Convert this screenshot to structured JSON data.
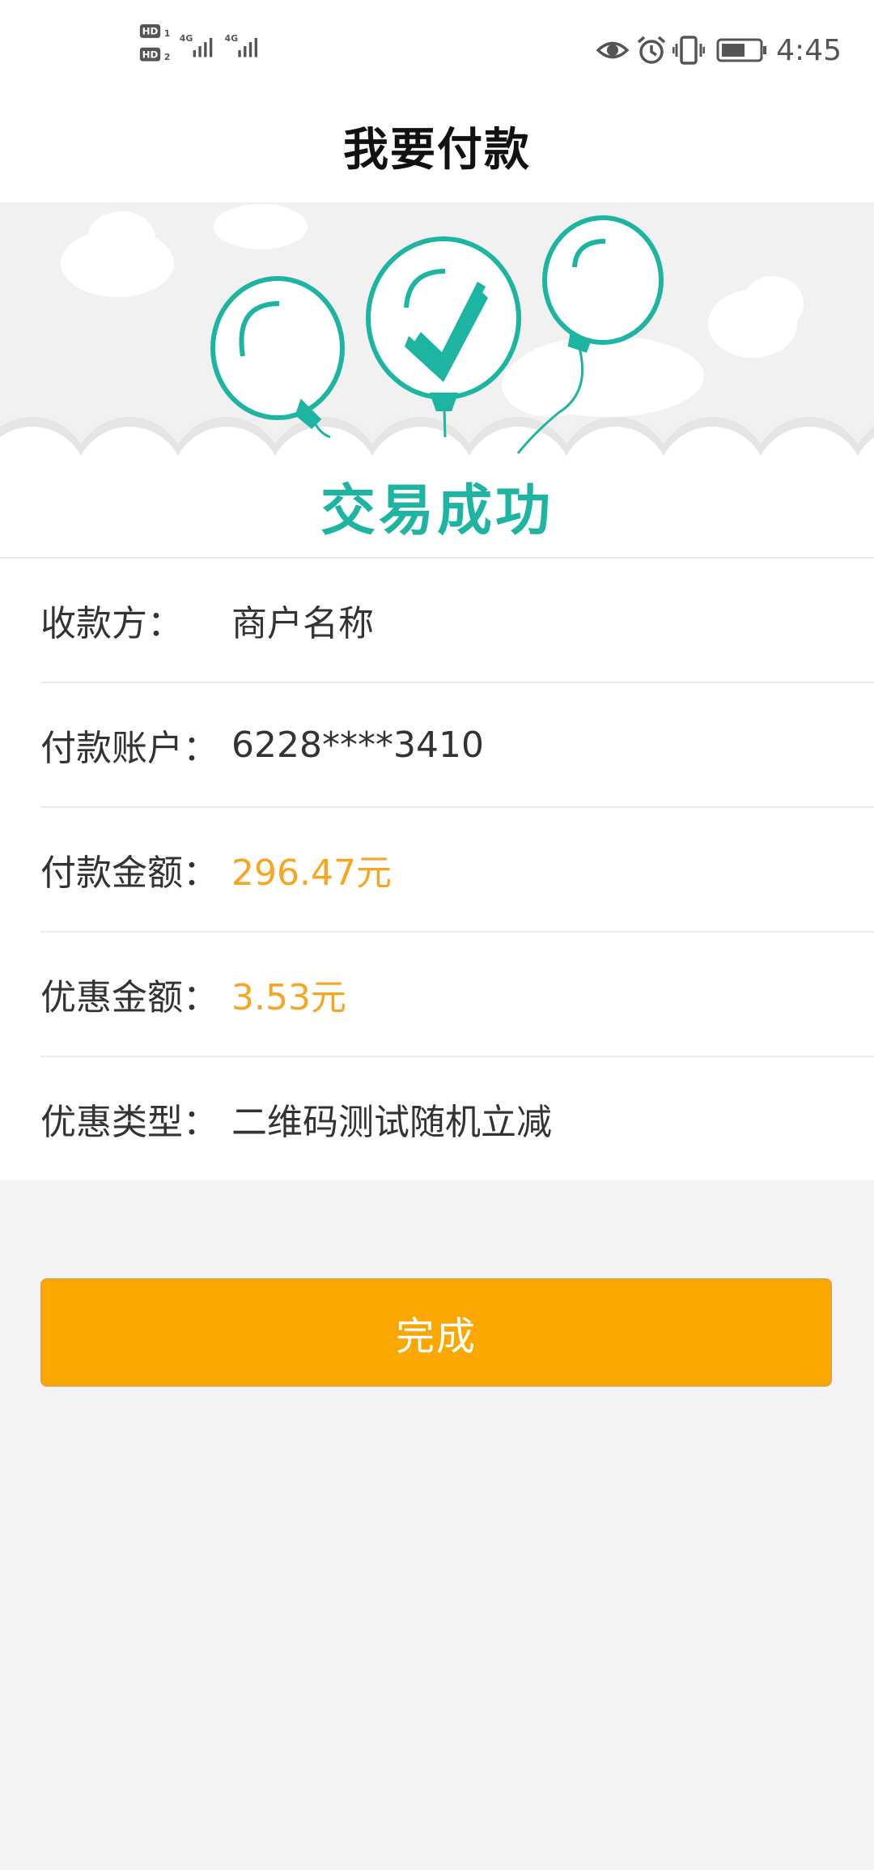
{
  "status_bar": {
    "sim1": "HD",
    "sim1_index": "1",
    "sim2": "HD",
    "sim2_index": "2",
    "network1": "4G",
    "network2": "4G",
    "time": "4:45",
    "icons": [
      "eye-icon",
      "alarm-icon",
      "vibrate-icon",
      "battery-icon"
    ]
  },
  "header": {
    "title": "我要付款"
  },
  "hero": {
    "status_text": "交易成功",
    "accent_color": "#1db5a2"
  },
  "details": {
    "rows": [
      {
        "label": "收款方：",
        "value": "商户名称"
      },
      {
        "label": "付款账户：",
        "value": "6228****3410"
      },
      {
        "label": "付款金额：",
        "value": "296.47元"
      },
      {
        "label": "优惠金额：",
        "value": "3.53元"
      },
      {
        "label": "优惠类型：",
        "value": "二维码测试随机立减"
      }
    ],
    "amount_color": "#f6a623"
  },
  "actions": {
    "done_label": "完成",
    "button_color": "#faa700"
  }
}
